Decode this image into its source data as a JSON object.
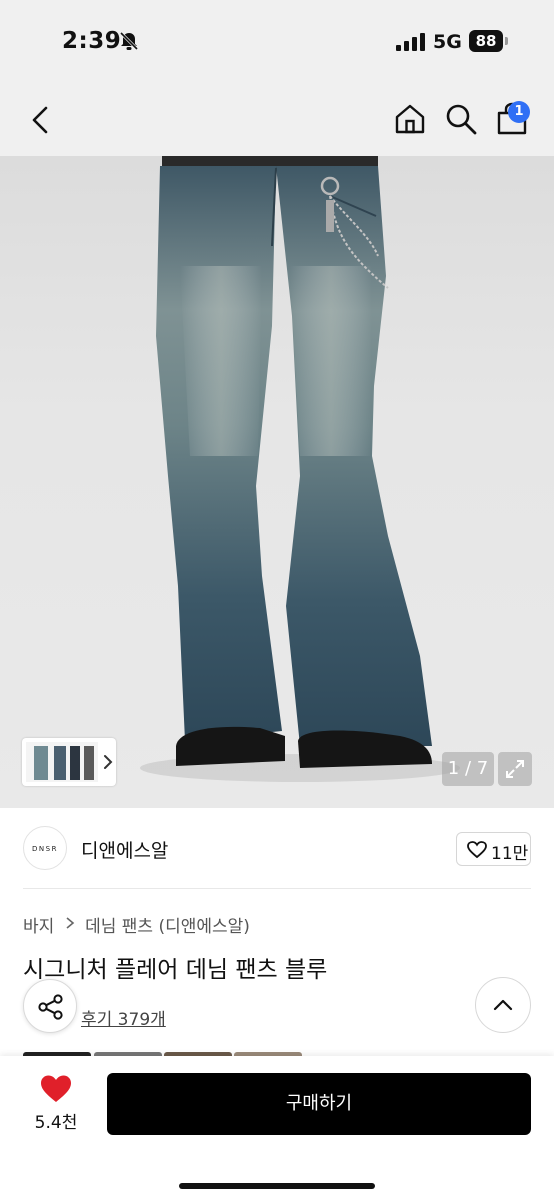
{
  "status_bar": {
    "time": "2:39",
    "network": "5G",
    "battery": "88"
  },
  "nav": {
    "cart_badge": "1"
  },
  "gallery": {
    "counter": "1 / 7"
  },
  "brand": {
    "logo_text": "DNSR",
    "name": "디앤에스알",
    "likes": "11만"
  },
  "breadcrumb": {
    "category": "바지",
    "subcategory": "데님 팬츠 (디앤에스알)"
  },
  "product": {
    "title": "시그니처 플레어 데님 팬츠 블루",
    "reviews": "후기 379개"
  },
  "bottom_bar": {
    "wish_count": "5.4천",
    "buy_label": "구매하기"
  },
  "colors": {
    "accent_blue": "#2f6ff5",
    "heart_red": "#e0202a",
    "buy_black": "#000000"
  }
}
